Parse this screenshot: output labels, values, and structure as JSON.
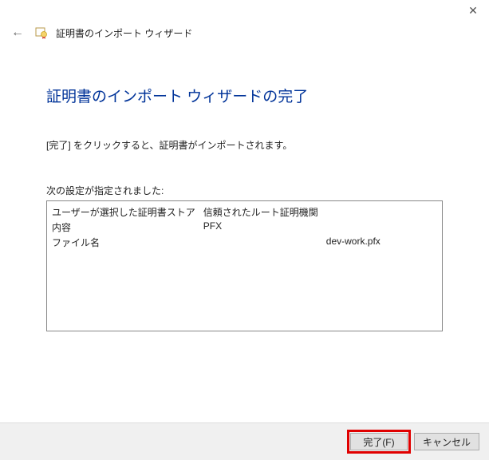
{
  "window": {
    "title": "証明書のインポート ウィザード"
  },
  "page": {
    "heading": "証明書のインポート ウィザードの完了",
    "instruction": "[完了] をクリックすると、証明書がインポートされます。",
    "settings_label": "次の設定が指定されました:"
  },
  "settings": {
    "rows": [
      {
        "key": "ユーザーが選択した証明書ストア",
        "val1": "信頼されたルート証明機関",
        "val2": ""
      },
      {
        "key": "内容",
        "val1": "PFX",
        "val2": ""
      },
      {
        "key": "ファイル名",
        "val1": "",
        "val2": "dev-work.pfx"
      }
    ]
  },
  "buttons": {
    "finish": "完了(F)",
    "cancel": "キャンセル"
  }
}
